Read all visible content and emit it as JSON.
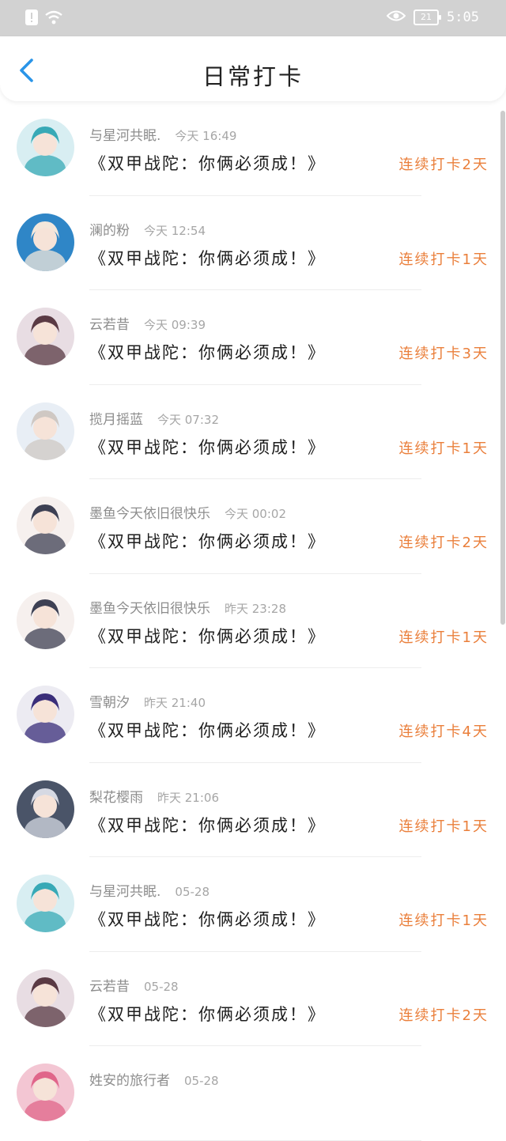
{
  "status_bar": {
    "battery": "21",
    "time": "5:05",
    "notification_icon": "alert-badge",
    "wifi_icon": "wifi",
    "eye_icon": "eye-comfort"
  },
  "header": {
    "title": "日常打卡",
    "back_icon": "chevron-left",
    "accent": "#2a95e8"
  },
  "colors": {
    "streak": "#ea7f3b"
  },
  "list": [
    {
      "name": "与星河共眠.",
      "time": "今天 16:49",
      "content": "《双甲战陀：你俩必须成！》",
      "streak": "连续打卡2天",
      "avatar_colors": [
        "#d8eef2",
        "#38a9b6"
      ]
    },
    {
      "name": "澜的粉",
      "time": "今天 12:54",
      "content": "《双甲战陀：你俩必须成！》",
      "streak": "连续打卡1天",
      "avatar_colors": [
        "#2f86c7",
        "#f3e7db"
      ]
    },
    {
      "name": "云若昔",
      "time": "今天 09:39",
      "content": "《双甲战陀：你俩必须成！》",
      "streak": "连续打卡3天",
      "avatar_colors": [
        "#e8dde3",
        "#5a3a44"
      ]
    },
    {
      "name": "揽月摇蓝",
      "time": "今天 07:32",
      "content": "《双甲战陀：你俩必须成！》",
      "streak": "连续打卡1天",
      "avatar_colors": [
        "#e8eef5",
        "#cfc8c3"
      ]
    },
    {
      "name": "墨鱼今天依旧很快乐",
      "time": "今天 00:02",
      "content": "《双甲战陀：你俩必须成！》",
      "streak": "连续打卡2天",
      "avatar_colors": [
        "#f6f0ee",
        "#3d4053"
      ]
    },
    {
      "name": "墨鱼今天依旧很快乐",
      "time": "昨天 23:28",
      "content": "《双甲战陀：你俩必须成！》",
      "streak": "连续打卡1天",
      "avatar_colors": [
        "#f6f0ee",
        "#3d4053"
      ]
    },
    {
      "name": "雪朝汐",
      "time": "昨天 21:40",
      "content": "《双甲战陀：你俩必须成！》",
      "streak": "连续打卡4天",
      "avatar_colors": [
        "#ecebf2",
        "#3a2e7a"
      ]
    },
    {
      "name": "梨花樱雨",
      "time": "昨天 21:06",
      "content": "《双甲战陀：你俩必须成！》",
      "streak": "连续打卡1天",
      "avatar_colors": [
        "#4a5468",
        "#d6d9e3"
      ]
    },
    {
      "name": "与星河共眠.",
      "time": "05-28",
      "content": "《双甲战陀：你俩必须成！》",
      "streak": "连续打卡1天",
      "avatar_colors": [
        "#d8eef2",
        "#38a9b6"
      ]
    },
    {
      "name": "云若昔",
      "time": "05-28",
      "content": "《双甲战陀：你俩必须成！》",
      "streak": "连续打卡2天",
      "avatar_colors": [
        "#e8dde3",
        "#5a3a44"
      ]
    },
    {
      "name": "姓安的旅行者",
      "time": "05-28",
      "content": "",
      "streak": "",
      "avatar_colors": [
        "#f3c6d3",
        "#e0668a"
      ]
    }
  ]
}
